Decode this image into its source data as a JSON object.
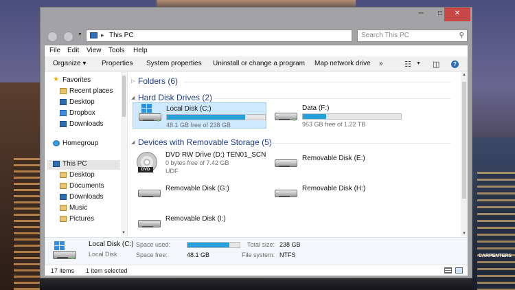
{
  "window": {
    "minimize": "─",
    "maximize": "□",
    "close": "✕"
  },
  "address": {
    "location": "This PC",
    "separator": "▸",
    "search_placeholder": "Search This PC",
    "dropdown": "▾",
    "refresh": "↻"
  },
  "menu": [
    "File",
    "Edit",
    "View",
    "Tools",
    "Help"
  ],
  "commands": {
    "organize": "Organize ▾",
    "properties": "Properties",
    "system_properties": "System properties",
    "uninstall": "Uninstall or change a program",
    "map_drive": "Map network drive",
    "more": "»"
  },
  "nav": {
    "favorites": "Favorites",
    "recent": "Recent places",
    "desktop": "Desktop",
    "dropbox": "Dropbox",
    "downloads": "Downloads",
    "homegroup": "Homegroup",
    "thispc": "This PC",
    "pc_desktop": "Desktop",
    "documents": "Documents",
    "pc_downloads": "Downloads",
    "music": "Music",
    "pictures": "Pictures"
  },
  "groups": {
    "folders": "Folders (6)",
    "hdd": "Hard Disk Drives (2)",
    "removable": "Devices with Removable Storage (5)"
  },
  "drives": {
    "c": {
      "name": "Local Disk (C:)",
      "free": "48.1 GB free of 238 GB",
      "used_fraction": 0.8
    },
    "f": {
      "name": "Data (F:)",
      "free": "953 GB free of 1.22 TB",
      "used_fraction": 0.24
    },
    "d": {
      "name": "DVD RW Drive (D:) TEN01_SCN",
      "free": "0 bytes free of 7.42 GB",
      "fs": "UDF",
      "badge": "DVD"
    },
    "e": {
      "name": "Removable Disk (E:)"
    },
    "g": {
      "name": "Removable Disk (G:)"
    },
    "h": {
      "name": "Removable Disk (H:)"
    },
    "i": {
      "name": "Removable Disk (I:)"
    }
  },
  "details": {
    "name": "Local Disk (C:)",
    "type": "Local Disk",
    "space_used_label": "Space used:",
    "space_free_label": "Space free:",
    "space_free": "48.1 GB",
    "total_size_label": "Total size:",
    "total_size": "238 GB",
    "fs_label": "File system:",
    "fs": "NTFS",
    "used_fraction": 0.8
  },
  "status": {
    "items": "17 items",
    "selected": "1 item selected"
  },
  "background_sign": "CARPENTERS",
  "colors": {
    "accent": "#26a0da",
    "selection": "#cde8ff",
    "close_button": "#c74646",
    "group_header": "#1e3a8a"
  }
}
